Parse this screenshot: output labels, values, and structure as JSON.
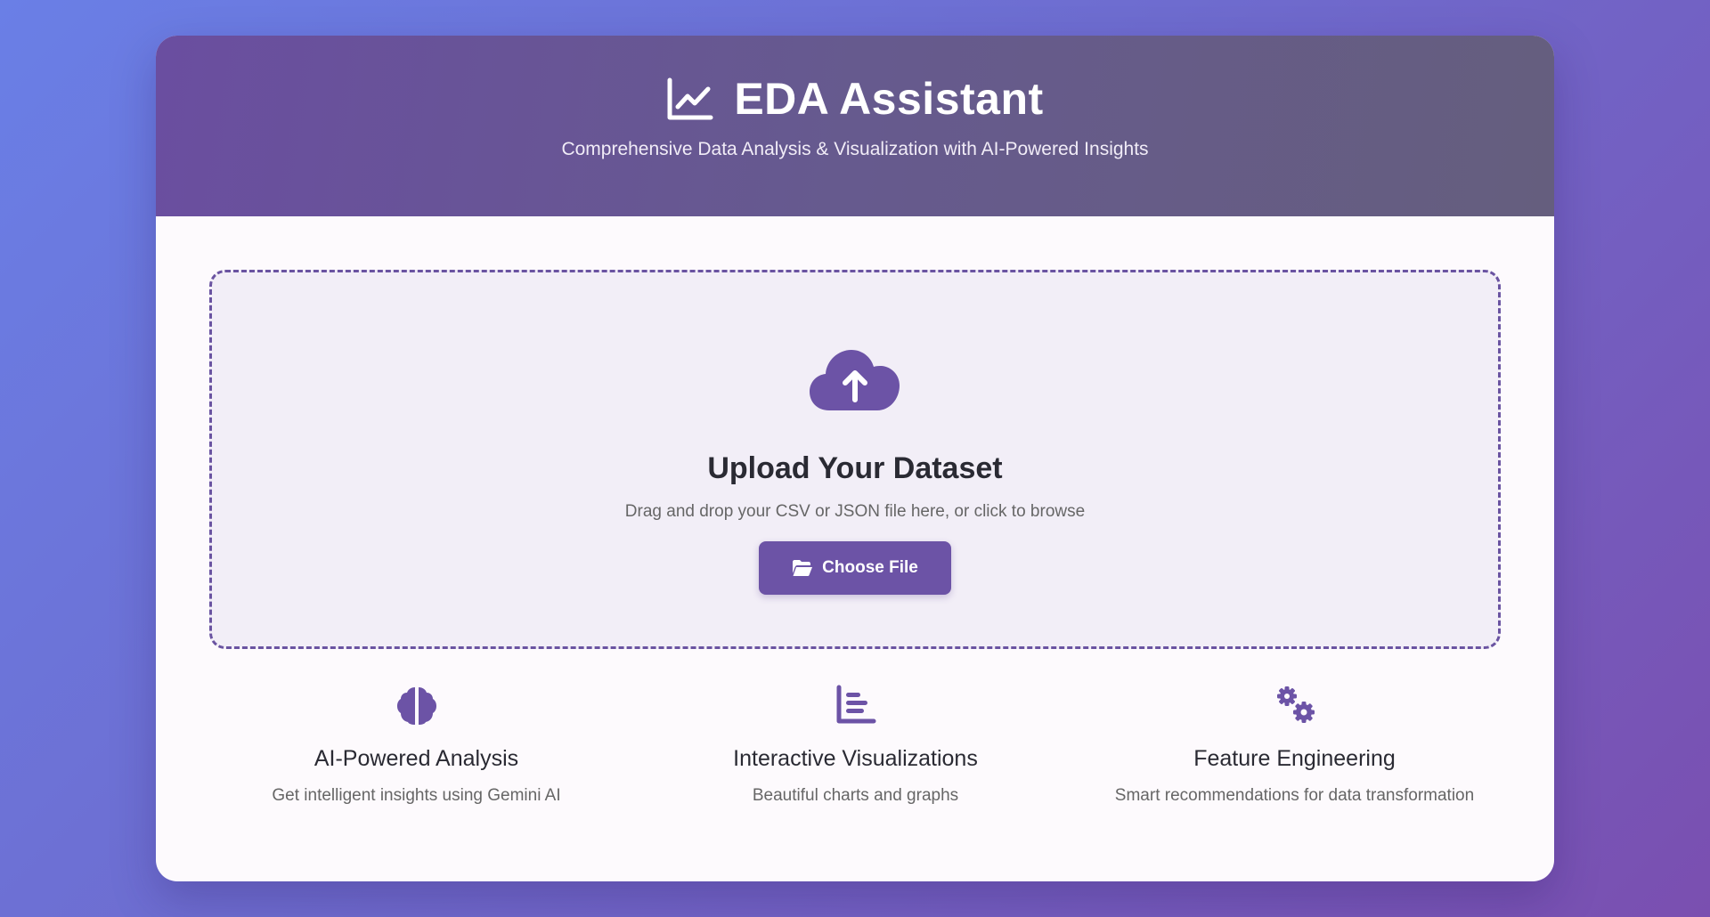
{
  "header": {
    "icon": "chart-line-icon",
    "title": "EDA Assistant",
    "subtitle": "Comprehensive Data Analysis & Visualization with AI-Powered Insights"
  },
  "upload": {
    "icon": "cloud-upload-icon",
    "title": "Upload Your Dataset",
    "description": "Drag and drop your CSV or JSON file here, or click to browse",
    "button_icon": "folder-open-icon",
    "button_label": "Choose File"
  },
  "features": [
    {
      "icon": "brain-icon",
      "title": "AI-Powered Analysis",
      "description": "Get intelligent insights using Gemini AI"
    },
    {
      "icon": "bar-chart-icon",
      "title": "Interactive Visualizations",
      "description": "Beautiful charts and graphs"
    },
    {
      "icon": "cogs-icon",
      "title": "Feature Engineering",
      "description": "Smart recommendations for data transformation"
    }
  ],
  "colors": {
    "accent": "#6c53a6",
    "header_start": "#6a4ea0",
    "header_end": "#655e7e",
    "card_bg": "#fdfafd",
    "dropzone_bg": "#f2eef7"
  }
}
